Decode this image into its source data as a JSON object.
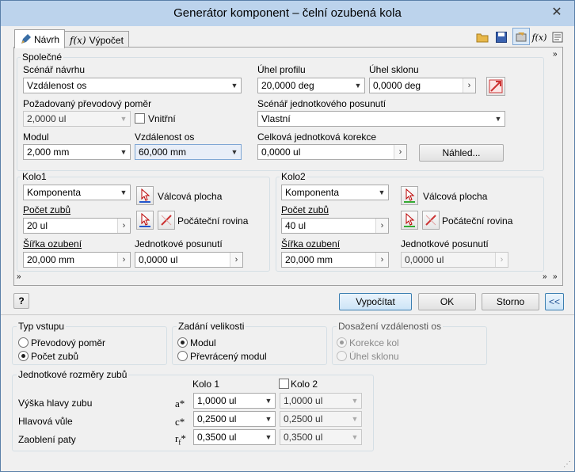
{
  "window": {
    "title": "Generátor komponent – čelní ozubená kola",
    "close": "✕"
  },
  "tabs": [
    {
      "label": "Návrh"
    },
    {
      "label": "Výpočet"
    }
  ],
  "common": {
    "group": "Společné",
    "scenario_label": "Scénář návrhu",
    "scenario_value": "Vzdálenost os",
    "ratio_label": "Požadovaný převodový poměr",
    "ratio_value": "2,0000 ul",
    "internal_label": "Vnitřní",
    "module_label": "Modul",
    "module_value": "2,000 mm",
    "center_label": "Vzdálenost os",
    "center_value": "60,000 mm",
    "pressure_label": "Úhel profilu",
    "pressure_value": "20,0000 deg",
    "helix_label": "Úhel sklonu",
    "helix_value": "0,0000 deg",
    "unitshift_label": "Scénář jednotkového posunutí",
    "unitshift_value": "Vlastní",
    "totalcorr_label": "Celková jednotková korekce",
    "totalcorr_value": "0,0000 ul",
    "preview_label": "Náhled..."
  },
  "gear1": {
    "group": "Kolo1",
    "type": "Komponenta",
    "cyl": "Válcová plocha",
    "teeth_label": "Počet zubů",
    "teeth_value": "20 ul",
    "start": "Počáteční rovina",
    "width_label": "Šířka ozubení",
    "width_value": "20,000 mm",
    "shift_label": "Jednotkové posunutí",
    "shift_value": "0,0000 ul"
  },
  "gear2": {
    "group": "Kolo2",
    "type": "Komponenta",
    "cyl": "Válcová plocha",
    "teeth_label": "Počet zubů",
    "teeth_value": "40 ul",
    "start": "Počáteční rovina",
    "width_label": "Šířka ozubení",
    "width_value": "20,000 mm",
    "shift_label": "Jednotkové posunutí",
    "shift_value": "0,0000 ul"
  },
  "actions": {
    "help": "?",
    "calculate": "Vypočítat",
    "ok": "OK",
    "cancel": "Storno",
    "collapse": "<<"
  },
  "input_type": {
    "group": "Typ vstupu",
    "opt1": "Převodový poměr",
    "opt2": "Počet zubů"
  },
  "size_input": {
    "group": "Zadání velikosti",
    "opt1": "Modul",
    "opt2": "Převrácený modul"
  },
  "center_dist": {
    "group": "Dosažení vzdálenosti os",
    "opt1": "Korekce kol",
    "opt2": "Úhel sklonu"
  },
  "unit_dims": {
    "group": "Jednotkové rozměry zubů",
    "col1": "Kolo 1",
    "col2": "Kolo 2",
    "rows": [
      {
        "label": "Výška hlavy zubu",
        "sym": "a*",
        "v1": "1,0000 ul",
        "v2": "1,0000 ul"
      },
      {
        "label": "Hlavová vůle",
        "sym": "c*",
        "v1": "0,2500 ul",
        "v2": "0,2500 ul"
      },
      {
        "label": "Zaoblení paty",
        "sym": "r",
        "sub": "f",
        "sup": "*",
        "v1": "0,3500 ul",
        "v2": "0,3500 ul"
      }
    ]
  },
  "colors": {
    "title_bg": "#bcd3ec",
    "default_btn": "#3c7fb1",
    "panel": "#f0f0f0"
  }
}
